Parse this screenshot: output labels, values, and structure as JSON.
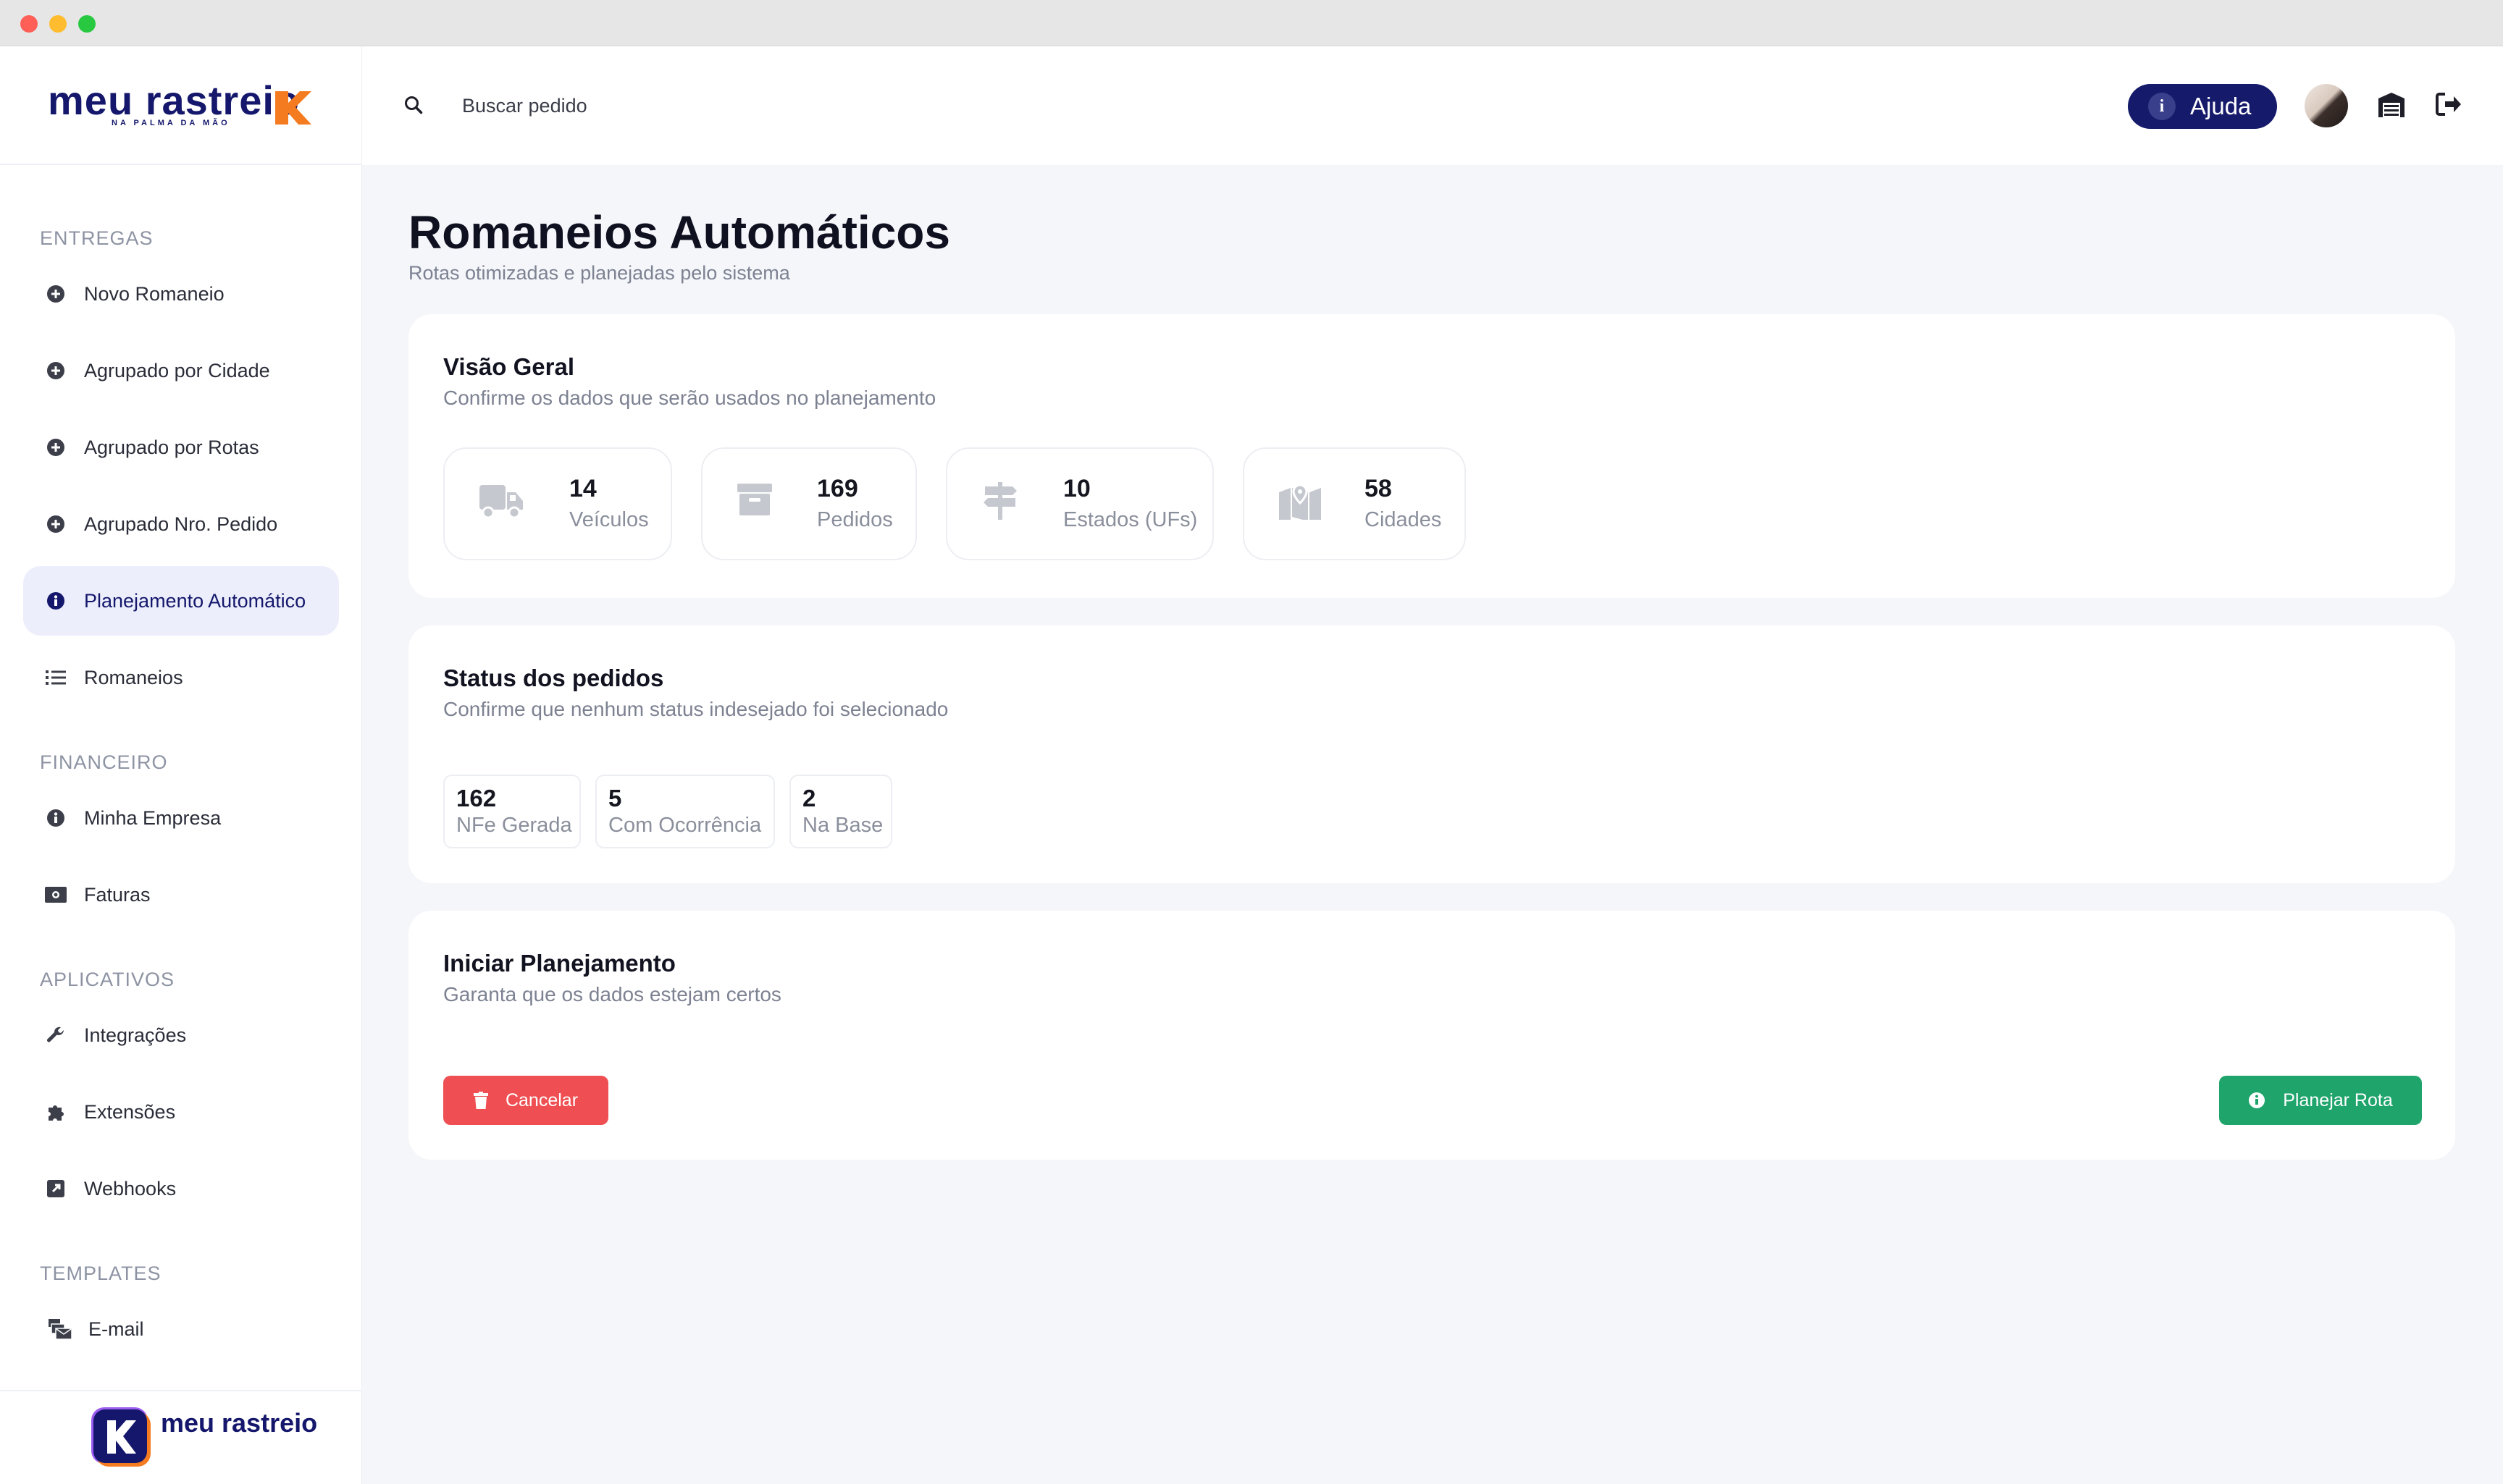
{
  "brand": {
    "name": "meu rastreio",
    "tagline": "NA PALMA DA MÃO",
    "accent": "#f47b20",
    "navy": "#14176b"
  },
  "sidebar": {
    "sections": [
      {
        "title": "ENTREGAS",
        "items": [
          {
            "label": "Novo Romaneio",
            "icon": "plus-circle-icon"
          },
          {
            "label": "Agrupado por Cidade",
            "icon": "plus-circle-icon"
          },
          {
            "label": "Agrupado por Rotas",
            "icon": "plus-circle-icon"
          },
          {
            "label": "Agrupado Nro. Pedido",
            "icon": "plus-circle-icon"
          },
          {
            "label": "Planejamento Automático",
            "icon": "info-circle-icon",
            "active": true
          },
          {
            "label": "Romaneios",
            "icon": "list-icon"
          }
        ]
      },
      {
        "title": "FINANCEIRO",
        "items": [
          {
            "label": "Minha Empresa",
            "icon": "info-circle-icon"
          },
          {
            "label": "Faturas",
            "icon": "money-bill-icon"
          }
        ]
      },
      {
        "title": "APLICATIVOS",
        "items": [
          {
            "label": "Integrações",
            "icon": "wrench-icon"
          },
          {
            "label": "Extensões",
            "icon": "puzzle-icon"
          },
          {
            "label": "Webhooks",
            "icon": "external-link-icon"
          }
        ]
      },
      {
        "title": "TEMPLATES",
        "items": [
          {
            "label": "E-mail",
            "icon": "mail-bulk-icon"
          }
        ]
      }
    ]
  },
  "topbar": {
    "search_placeholder": "Buscar pedido",
    "help_label": "Ajuda"
  },
  "page": {
    "title": "Romaneios Automáticos",
    "subtitle": "Rotas otimizadas e planejadas pelo sistema"
  },
  "overview": {
    "title": "Visão Geral",
    "subtitle": "Confirme os dados que serão usados no planejamento",
    "stats": [
      {
        "value": "14",
        "label": "Veículos",
        "icon": "truck-icon"
      },
      {
        "value": "169",
        "label": "Pedidos",
        "icon": "archive-box-icon"
      },
      {
        "value": "10",
        "label": "Estados (UFs)",
        "icon": "signpost-icon"
      },
      {
        "value": "58",
        "label": "Cidades",
        "icon": "map-marker-icon"
      }
    ]
  },
  "status": {
    "title": "Status dos pedidos",
    "subtitle": "Confirme que nenhum status indesejado foi selecionado",
    "items": [
      {
        "value": "162",
        "label": "NFe Gerada"
      },
      {
        "value": "5",
        "label": "Com Ocorrência"
      },
      {
        "value": "2",
        "label": "Na Base"
      }
    ]
  },
  "start": {
    "title": "Iniciar Planejamento",
    "subtitle": "Garanta que os dados estejam certos",
    "cancel_label": "Cancelar",
    "plan_label": "Planejar Rota"
  }
}
